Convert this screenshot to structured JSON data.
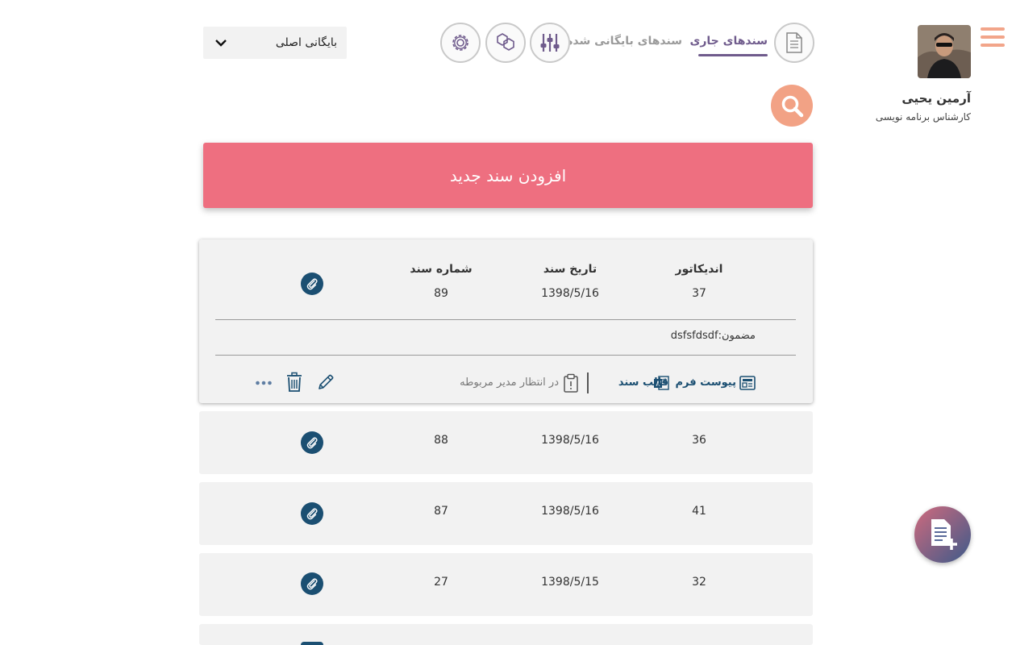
{
  "user": {
    "name": "آرمین یحیی",
    "role": "کارشناس برنامه نویسی"
  },
  "nav": {
    "tab_current": "سندهای جاری",
    "tab_archived": "سندهای بایگانی شده"
  },
  "archive_select": {
    "selected": "بایگانی اصلی"
  },
  "add_button": {
    "label": "افزودن سند جدید"
  },
  "columns": {
    "indicator": "اندیکاتور",
    "date": "تاریخ سند",
    "number": "شماره سند"
  },
  "expanded_doc": {
    "indicator": "37",
    "date": "1398/5/16",
    "number": "89",
    "subject_label": "مضمون:",
    "subject_value": "dsfsfdsdf",
    "form_attachment": "پیوست فرم",
    "doc_template": "قالب سند",
    "status": "در انتظار مدیر مربوطه"
  },
  "rows": [
    {
      "indicator": "36",
      "date": "1398/5/16",
      "number": "88"
    },
    {
      "indicator": "41",
      "date": "1398/5/16",
      "number": "87"
    },
    {
      "indicator": "32",
      "date": "1398/5/15",
      "number": "27"
    }
  ],
  "icons": {
    "menu": "hamburger-icon",
    "document": "document-icon",
    "sliders": "sliders-icon",
    "hexagons": "hexagons-icon",
    "settings": "gear-icon",
    "search": "search-icon",
    "attachment": "paperclip-icon",
    "edit": "pencil-icon",
    "delete": "trash-icon",
    "more": "more-dots-icon",
    "form": "form-icon",
    "word": "word-icon",
    "clipboard": "clipboard-icon",
    "add_document": "add-document-icon"
  },
  "colors": {
    "accent_purple": "#6f5b8c",
    "add_button": "#ee6f80",
    "search": "#f2a285",
    "menu": "#f2a58a",
    "link_blue": "#1b4f72",
    "card_bg": "#f2f2f2"
  }
}
